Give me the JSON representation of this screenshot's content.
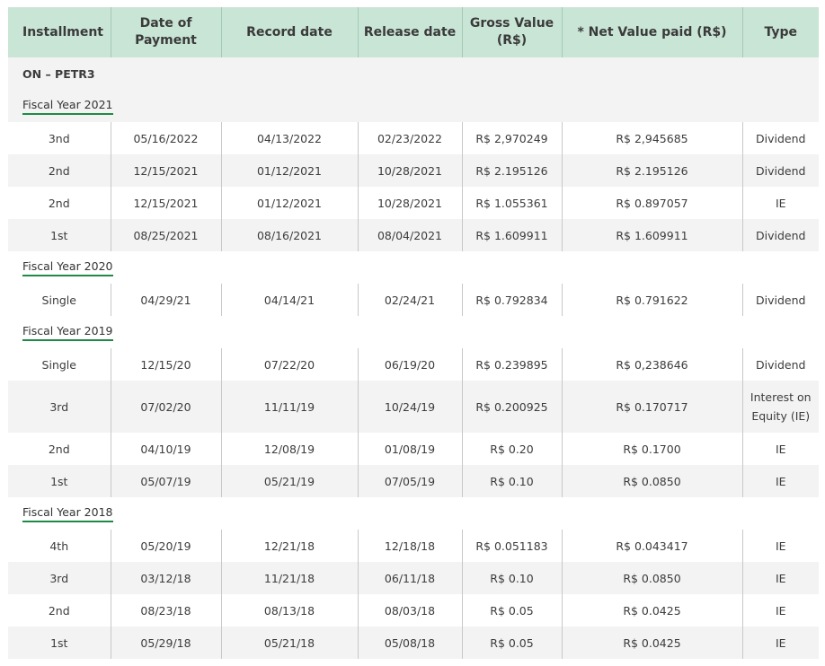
{
  "header": {
    "installment": "Installment",
    "date_of_payment": "Date of Payment",
    "record_date": "Record date",
    "release_date": "Release date",
    "gross_value": "Gross Value (R$)",
    "net_value": "* Net Value paid (R$)",
    "type": "Type"
  },
  "group_label": "ON – PETR3",
  "fiscal_years": [
    {
      "label": "Fiscal Year 2021",
      "rows": [
        {
          "installment": "3nd",
          "payment": "05/16/2022",
          "record": "04/13/2022",
          "release": "02/23/2022",
          "gross": "R$ 2,970249",
          "net": "R$ 2,945685",
          "type": "Dividend"
        },
        {
          "installment": "2nd",
          "payment": "12/15/2021",
          "record": "01/12/2021",
          "release": "10/28/2021",
          "gross": "R$ 2.195126",
          "net": "R$ 2.195126",
          "type": "Dividend"
        },
        {
          "installment": "2nd",
          "payment": "12/15/2021",
          "record": "01/12/2021",
          "release": "10/28/2021",
          "gross": "R$ 1.055361",
          "net": "R$ 0.897057",
          "type": "IE"
        },
        {
          "installment": "1st",
          "payment": "08/25/2021",
          "record": "08/16/2021",
          "release": "08/04/2021",
          "gross": "R$ 1.609911",
          "net": "R$ 1.609911",
          "type": "Dividend"
        }
      ]
    },
    {
      "label": "Fiscal Year 2020",
      "rows": [
        {
          "installment": "Single",
          "payment": "04/29/21",
          "record": "04/14/21",
          "release": "02/24/21",
          "gross": "R$ 0.792834",
          "net": "R$ 0.791622",
          "type": "Dividend"
        }
      ]
    },
    {
      "label": "Fiscal Year 2019",
      "rows": [
        {
          "installment": "Single",
          "payment": "12/15/20",
          "record": "07/22/20",
          "release": "06/19/20",
          "gross": "R$ 0.239895",
          "net": "R$ 0,238646",
          "type": "Dividend"
        },
        {
          "installment": "3rd",
          "payment": "07/02/20",
          "record": "11/11/19",
          "release": "10/24/19",
          "gross": "R$ 0.200925",
          "net": "R$ 0.170717",
          "type": "Interest on Equity (IE)"
        },
        {
          "installment": "2nd",
          "payment": "04/10/19",
          "record": "12/08/19",
          "release": "01/08/19",
          "gross": "R$ 0.20",
          "net": "R$ 0.1700",
          "type": "IE"
        },
        {
          "installment": "1st",
          "payment": "05/07/19",
          "record": "05/21/19",
          "release": "07/05/19",
          "gross": "R$ 0.10",
          "net": "R$ 0.0850",
          "type": "IE"
        }
      ]
    },
    {
      "label": "Fiscal Year 2018",
      "rows": [
        {
          "installment": "4th",
          "payment": "05/20/19",
          "record": "12/21/18",
          "release": "12/18/18",
          "gross": "R$ 0.051183",
          "net": "R$ 0.043417",
          "type": "IE"
        },
        {
          "installment": "3rd",
          "payment": "03/12/18",
          "record": "11/21/18",
          "release": "06/11/18",
          "gross": "R$ 0.10",
          "net": "R$ 0.0850",
          "type": "IE"
        },
        {
          "installment": "2nd",
          "payment": "08/23/18",
          "record": "08/13/18",
          "release": "08/03/18",
          "gross": "R$ 0.05",
          "net": "R$ 0.0425",
          "type": "IE"
        },
        {
          "installment": "1st",
          "payment": "05/29/18",
          "record": "05/21/18",
          "release": "05/08/18",
          "gross": "R$ 0.05",
          "net": "R$ 0.0425",
          "type": "IE"
        }
      ]
    }
  ],
  "colors": {
    "header_bg": "#c9e5d6",
    "stripe": "#f3f3f3",
    "fiscal_underline": "#1e8a46"
  }
}
